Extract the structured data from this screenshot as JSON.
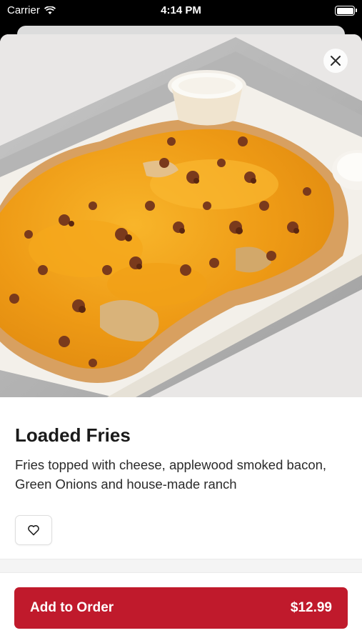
{
  "status_bar": {
    "carrier": "Carrier",
    "time": "4:14 PM"
  },
  "item": {
    "title": "Loaded Fries",
    "description": "Fries topped with cheese, applewood smoked bacon, Green Onions and house-made ranch",
    "image_alt_icon": "loaded-fries-photo"
  },
  "actions": {
    "close_icon": "close-icon",
    "favorite_icon": "heart-icon",
    "add_label": "Add to Order",
    "price": "$12.99"
  },
  "colors": {
    "primary": "#c01a2c",
    "cheese": "#f0a51e",
    "bacon": "#7a3a1c"
  }
}
